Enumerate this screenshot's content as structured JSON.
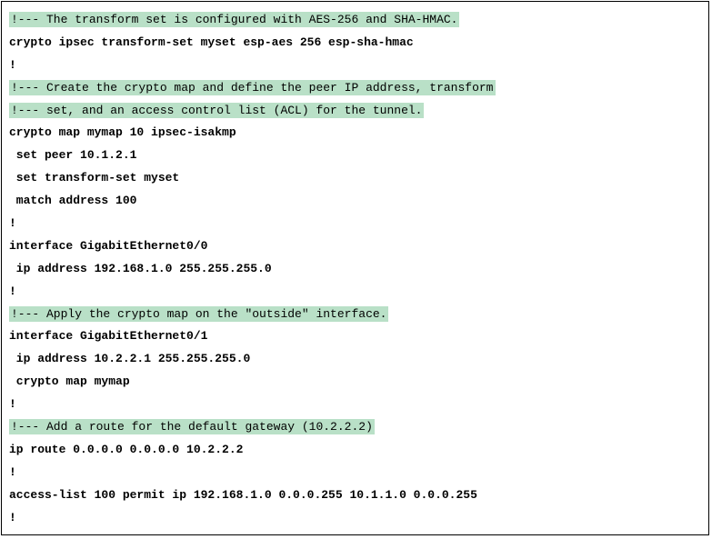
{
  "lines": [
    {
      "type": "comment",
      "text": "!--- The transform set is configured with AES-256 and SHA-HMAC."
    },
    {
      "type": "code",
      "text": "crypto ipsec transform-set myset esp-aes 256 esp-sha-hmac"
    },
    {
      "type": "code",
      "text": "!"
    },
    {
      "type": "comment",
      "text": "!--- Create the crypto map and define the peer IP address, transform"
    },
    {
      "type": "comment",
      "text": "!--- set, and an access control list (ACL) for the tunnel."
    },
    {
      "type": "code",
      "text": "crypto map mymap 10 ipsec-isakmp"
    },
    {
      "type": "code",
      "text": " set peer 10.1.2.1"
    },
    {
      "type": "code",
      "text": " set transform-set myset"
    },
    {
      "type": "code",
      "text": " match address 100"
    },
    {
      "type": "code",
      "text": "!"
    },
    {
      "type": "code",
      "text": "interface GigabitEthernet0/0"
    },
    {
      "type": "code",
      "text": " ip address 192.168.1.0 255.255.255.0"
    },
    {
      "type": "code",
      "text": "!"
    },
    {
      "type": "comment",
      "text": "!--- Apply the crypto map on the \"outside\" interface."
    },
    {
      "type": "code",
      "text": "interface GigabitEthernet0/1"
    },
    {
      "type": "code",
      "text": " ip address 10.2.2.1 255.255.255.0"
    },
    {
      "type": "code",
      "text": " crypto map mymap"
    },
    {
      "type": "code",
      "text": "!"
    },
    {
      "type": "comment",
      "text": "!--- Add a route for the default gateway (10.2.2.2)"
    },
    {
      "type": "code",
      "text": "ip route 0.0.0.0 0.0.0.0 10.2.2.2"
    },
    {
      "type": "code",
      "text": "!"
    },
    {
      "type": "code",
      "text": "access-list 100 permit ip 192.168.1.0 0.0.0.255 10.1.1.0 0.0.0.255"
    },
    {
      "type": "code",
      "text": "!"
    }
  ]
}
